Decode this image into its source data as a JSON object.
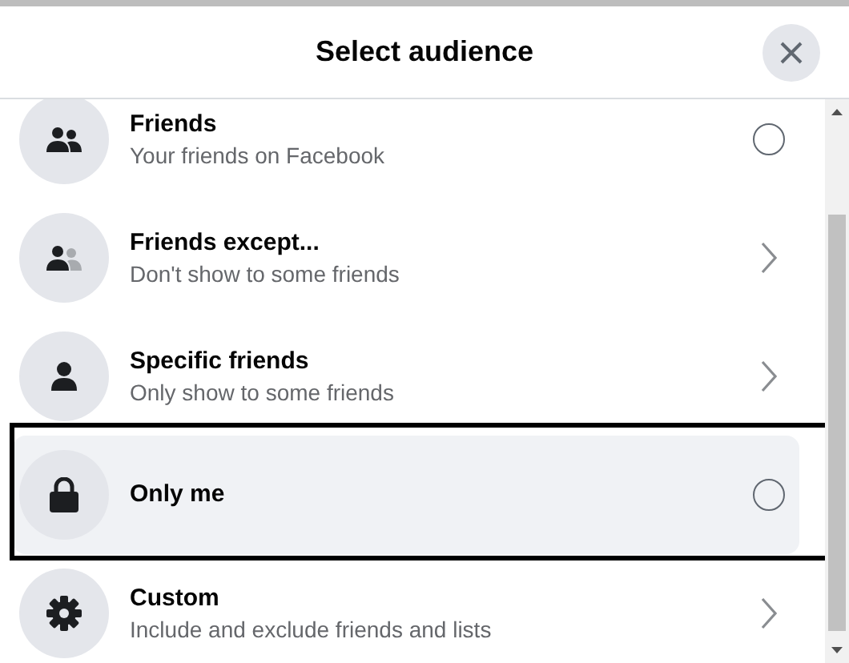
{
  "dialog": {
    "title": "Select audience"
  },
  "options": [
    {
      "kind": "radio",
      "title": "Friends",
      "subtitle": "Your friends on Facebook",
      "selected": false,
      "highlighted": false,
      "outlined": false
    },
    {
      "kind": "chevron",
      "title": "Friends except...",
      "subtitle": "Don't show to some friends",
      "highlighted": false,
      "outlined": false
    },
    {
      "kind": "chevron",
      "title": "Specific friends",
      "subtitle": "Only show to some friends",
      "highlighted": false,
      "outlined": false
    },
    {
      "kind": "radio",
      "title": "Only me",
      "selected": false,
      "highlighted": true,
      "outlined": true
    },
    {
      "kind": "chevron",
      "title": "Custom",
      "subtitle": "Include and exclude friends and lists",
      "highlighted": false,
      "outlined": false
    }
  ]
}
